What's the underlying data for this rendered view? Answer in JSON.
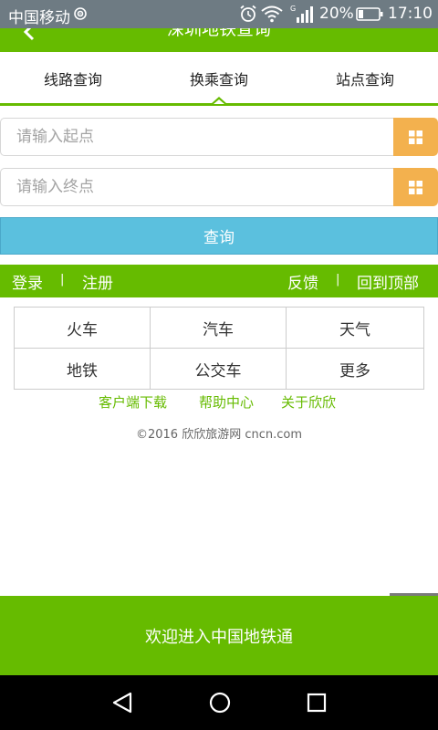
{
  "status_bar": {
    "carrier": "中国移动",
    "battery_percent": "20%",
    "time": "17:10",
    "network_type": "G"
  },
  "header": {
    "title": "深圳地铁查询"
  },
  "tabs": [
    {
      "label": "线路查询"
    },
    {
      "label": "换乘查询",
      "active": true
    },
    {
      "label": "站点查询"
    }
  ],
  "inputs": {
    "start_placeholder": "请输入起点",
    "end_placeholder": "请输入终点"
  },
  "search_label": "查询",
  "link_bar": {
    "login": "登录",
    "register": "注册",
    "feedback": "反馈",
    "back_to_top": "回到顶部",
    "separator": "|"
  },
  "categories": [
    {
      "label": "火车"
    },
    {
      "label": "汽车"
    },
    {
      "label": "天气"
    },
    {
      "label": "地铁"
    },
    {
      "label": "公交车"
    },
    {
      "label": "更多"
    }
  ],
  "footer": {
    "client_download": "客户端下载",
    "help_center": "帮助中心",
    "about": "关于欣欣",
    "copyright": "©2016 欣欣旅游网 cncn.com"
  },
  "banner": "欢迎进入中国地铁通",
  "colors": {
    "brand_green": "#66bb00",
    "search_blue": "#5bc0de",
    "grid_orange": "#f3b14e"
  },
  "icons": {
    "back": "chevron-left-icon",
    "grid": "grid-icon",
    "nav_back": "triangle-back-icon",
    "nav_home": "circle-home-icon",
    "nav_recent": "square-recent-icon"
  }
}
